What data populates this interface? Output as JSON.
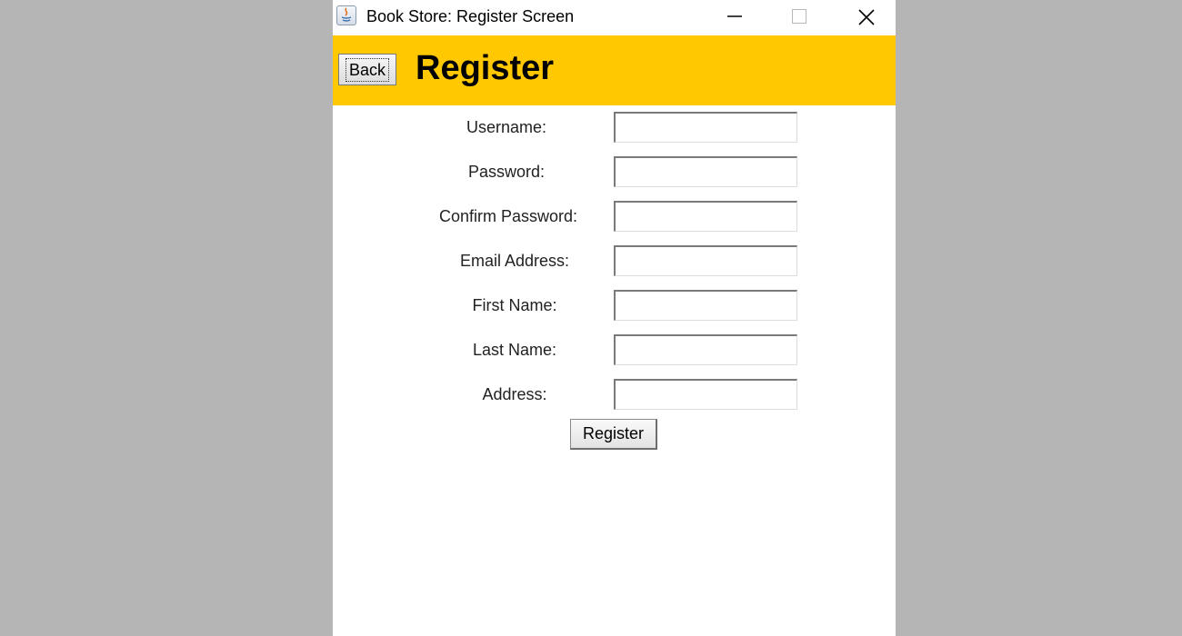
{
  "window": {
    "title": "Book Store: Register Screen",
    "controls": [
      "minimize-icon",
      "maximize-icon",
      "close-icon"
    ]
  },
  "header": {
    "back_label": "Back",
    "title": "Register",
    "background": "#ffc800"
  },
  "form": {
    "fields": [
      {
        "label": "Username:",
        "value": ""
      },
      {
        "label": "Password:",
        "value": ""
      },
      {
        "label": "Confirm Password:",
        "value": ""
      },
      {
        "label": "Email Address:",
        "value": ""
      },
      {
        "label": "First Name:",
        "value": ""
      },
      {
        "label": "Last Name:",
        "value": ""
      },
      {
        "label": "Address:",
        "value": ""
      }
    ],
    "submit_label": "Register"
  }
}
